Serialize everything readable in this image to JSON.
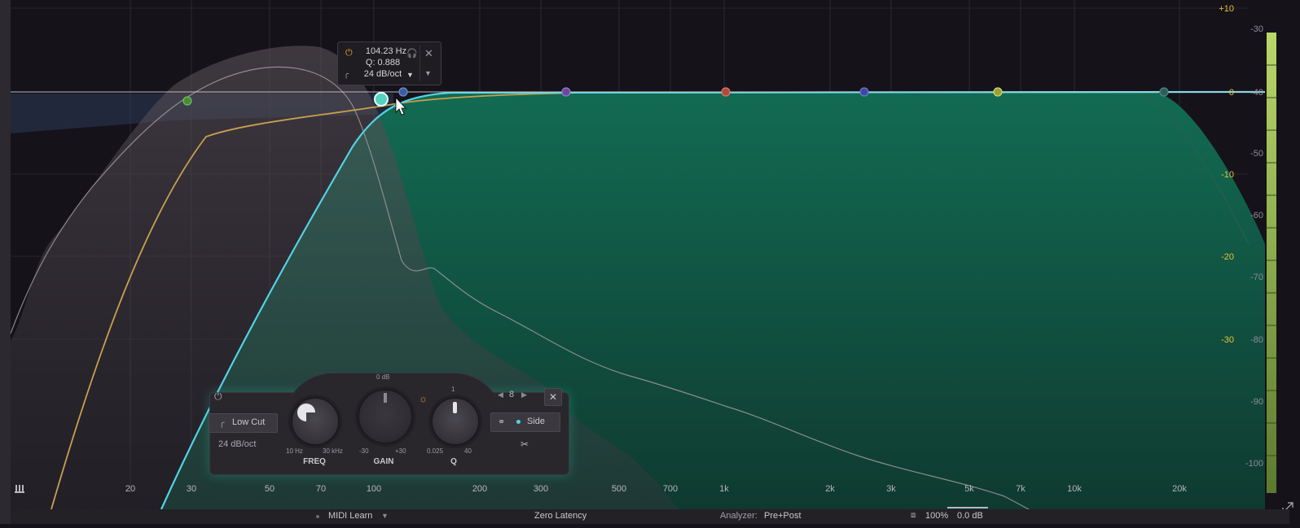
{
  "popup": {
    "frequency": "104.23 Hz",
    "q": "Q: 0.888",
    "slope": "24 dB/oct",
    "power_icon": "power-icon",
    "listen_icon": "headphones-icon",
    "close_icon": "close-icon"
  },
  "panel": {
    "band_type": "Low Cut",
    "slope": "24 dB/oct",
    "freq_label": "FREQ",
    "gain_label": "GAIN",
    "q_label": "Q",
    "freq_min": "10 Hz",
    "freq_max": "30 kHz",
    "gain_top": "0 dB",
    "gain_min": "-30",
    "gain_max": "+30",
    "q_min": "0.025",
    "q_max": "40",
    "q_top": "1",
    "band_number": "8",
    "stereo_mode": "Side"
  },
  "freq_axis": [
    "20",
    "30",
    "50",
    "70",
    "100",
    "200",
    "300",
    "500",
    "700",
    "1k",
    "2k",
    "3k",
    "5k",
    "7k",
    "10k",
    "20k"
  ],
  "gain_scale_yellow": [
    "+10",
    "0",
    "-10",
    "-20",
    "-30"
  ],
  "analyzer_scale": [
    "-30",
    "-40",
    "-50",
    "-60",
    "-70",
    "-80",
    "-90",
    "-100"
  ],
  "status": {
    "midi_learn": "MIDI Learn",
    "latency": "Zero Latency",
    "analyzer_label": "Analyzer:",
    "analyzer_value": "Pre+Post",
    "zoom": "100%",
    "output_gain": "0.0 dB"
  },
  "colors": {
    "background": "#15121a",
    "selected_band": "#53d3e6",
    "fill": "#13674e",
    "curve": "#c8b27a",
    "accent_yellow": "#e3c33c"
  }
}
